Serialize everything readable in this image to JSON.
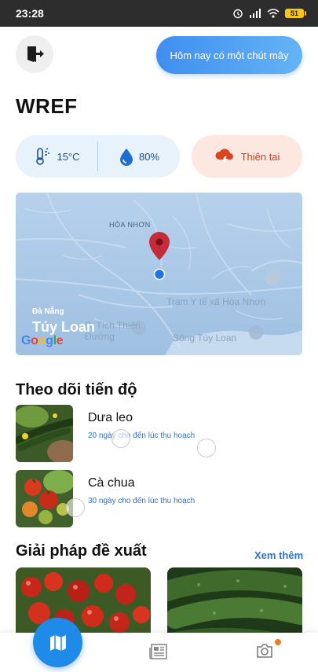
{
  "status": {
    "time": "23:28",
    "battery": "51"
  },
  "header": {
    "weather_summary": "Hôm nay có một chút mây",
    "brand": "WREF"
  },
  "stats": {
    "temperature": "15°C",
    "humidity": "80%",
    "disaster_label": "Thiên tai"
  },
  "map": {
    "area_label": "HÒA NHƠN",
    "city": "Đà Nẵng",
    "place": "Túy Loan",
    "poi_clinic": "Trạm Y tế xã Hòa Nhơn",
    "poi_site": "Di Tích Thiên Đường",
    "poi_river": "Sông Túy Loan",
    "logo": "Google"
  },
  "progress": {
    "title": "Theo dõi tiến độ",
    "items": [
      {
        "name": "Dưa leo",
        "note": "20 ngày cho đến lúc thu hoạch"
      },
      {
        "name": "Cà chua",
        "note": "30 ngày cho đến lúc thu hoạch"
      }
    ]
  },
  "solutions": {
    "title": "Giải pháp đề xuất",
    "see_more": "Xem thêm"
  },
  "colors": {
    "accent": "#1f8ae8",
    "link": "#2f73c8",
    "disaster": "#c8401c"
  }
}
